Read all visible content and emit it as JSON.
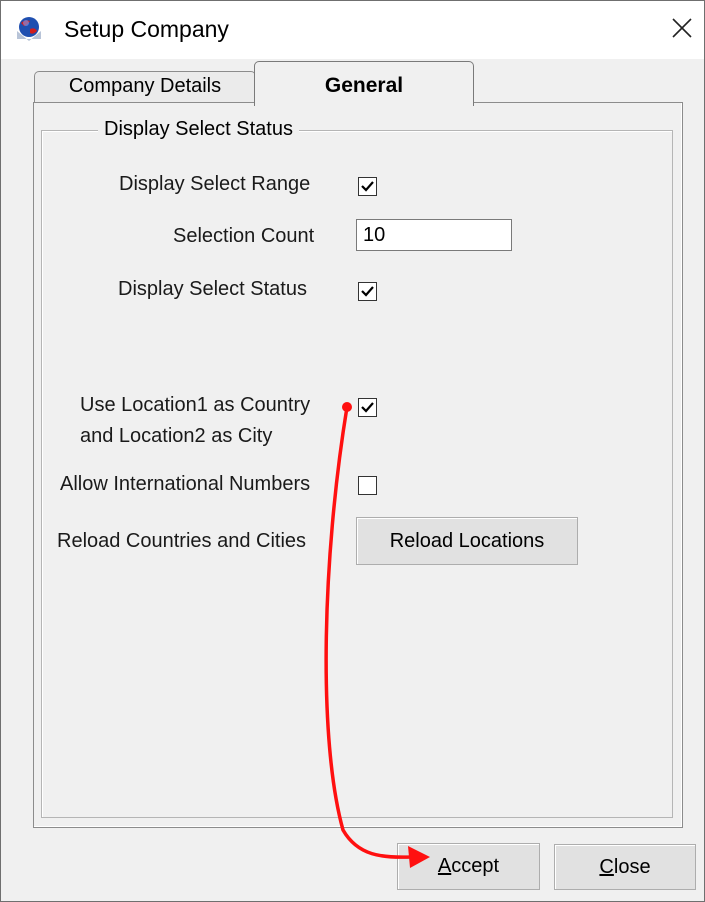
{
  "window": {
    "title": "Setup Company"
  },
  "tabs": [
    {
      "label": "Company Details",
      "active": false
    },
    {
      "label": "General",
      "active": true
    }
  ],
  "group": {
    "title": "Display Select Status"
  },
  "fields": {
    "display_select_range": {
      "label": "Display Select Range",
      "checked": true
    },
    "selection_count": {
      "label": "Selection Count",
      "value": "10"
    },
    "display_select_status": {
      "label": "Display Select Status",
      "checked": true
    },
    "use_location": {
      "label_line1": "Use Location1 as Country",
      "label_line2": "and Location2 as City",
      "checked": true
    },
    "allow_international": {
      "label": "Allow International Numbers",
      "checked": false
    },
    "reload": {
      "label": "Reload Countries and Cities",
      "button": "Reload Locations"
    }
  },
  "buttons": {
    "accept_mnemonic": "A",
    "accept_rest": "ccept",
    "close_mnemonic": "C",
    "close_rest": "lose"
  },
  "annotation": {
    "arrow_color": "#ff1010"
  },
  "icons": [
    "app-globe-icon",
    "close-icon",
    "checkmark-icon"
  ]
}
